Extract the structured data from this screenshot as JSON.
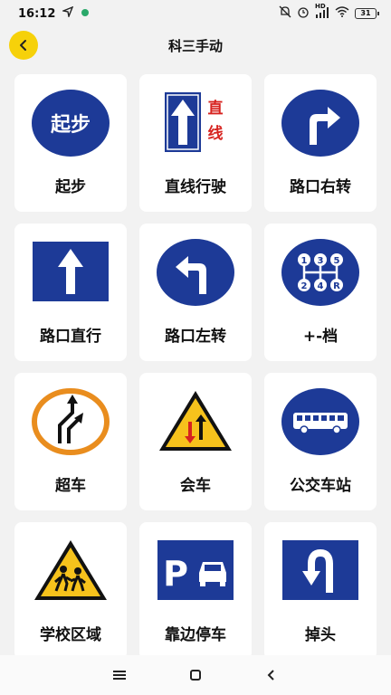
{
  "status": {
    "time": "16:12",
    "battery": "31",
    "network_label": "HD"
  },
  "header": {
    "title": "科三手动"
  },
  "cards": [
    {
      "label": "起步",
      "sign_text": "起步"
    },
    {
      "label": "直线行驶",
      "sign_text_1": "直",
      "sign_text_2": "线"
    },
    {
      "label": "路口右转"
    },
    {
      "label": "路口直行"
    },
    {
      "label": "路口左转"
    },
    {
      "label": "+-档",
      "gear_labels": [
        "1",
        "3",
        "5",
        "2",
        "4",
        "R"
      ]
    },
    {
      "label": "超车"
    },
    {
      "label": "会车"
    },
    {
      "label": "公交车站"
    },
    {
      "label": "学校区域"
    },
    {
      "label": "靠边停车",
      "sign_text": "P"
    },
    {
      "label": "掉头"
    }
  ],
  "colors": {
    "accent": "#f6d10a",
    "sign_blue": "#1d3a97",
    "warning_yellow": "#f6c21c",
    "sign_red": "#d7231f",
    "overtake_orange": "#e98d1e"
  }
}
